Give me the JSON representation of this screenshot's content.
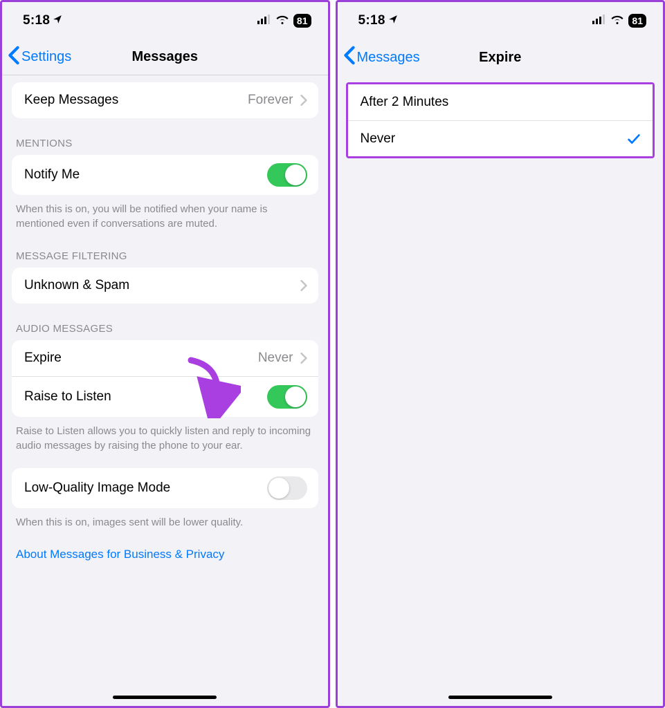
{
  "status": {
    "time": "5:18",
    "battery": "81"
  },
  "left": {
    "nav": {
      "back": "Settings",
      "title": "Messages"
    },
    "keepMessages": {
      "label": "Keep Messages",
      "value": "Forever"
    },
    "mentions": {
      "header": "MENTIONS",
      "notifyMe": "Notify Me",
      "footer": "When this is on, you will be notified when your name is mentioned even if conversations are muted."
    },
    "filtering": {
      "header": "MESSAGE FILTERING",
      "unknown": "Unknown & Spam"
    },
    "audio": {
      "header": "AUDIO MESSAGES",
      "expire": {
        "label": "Expire",
        "value": "Never"
      },
      "raise": "Raise to Listen",
      "footer": "Raise to Listen allows you to quickly listen and reply to incoming audio messages by raising the phone to your ear."
    },
    "lowQuality": {
      "label": "Low-Quality Image Mode",
      "footer": "When this is on, images sent will be lower quality."
    },
    "link": "About Messages for Business & Privacy"
  },
  "right": {
    "nav": {
      "back": "Messages",
      "title": "Expire"
    },
    "options": {
      "after2": "After 2 Minutes",
      "never": "Never"
    }
  }
}
